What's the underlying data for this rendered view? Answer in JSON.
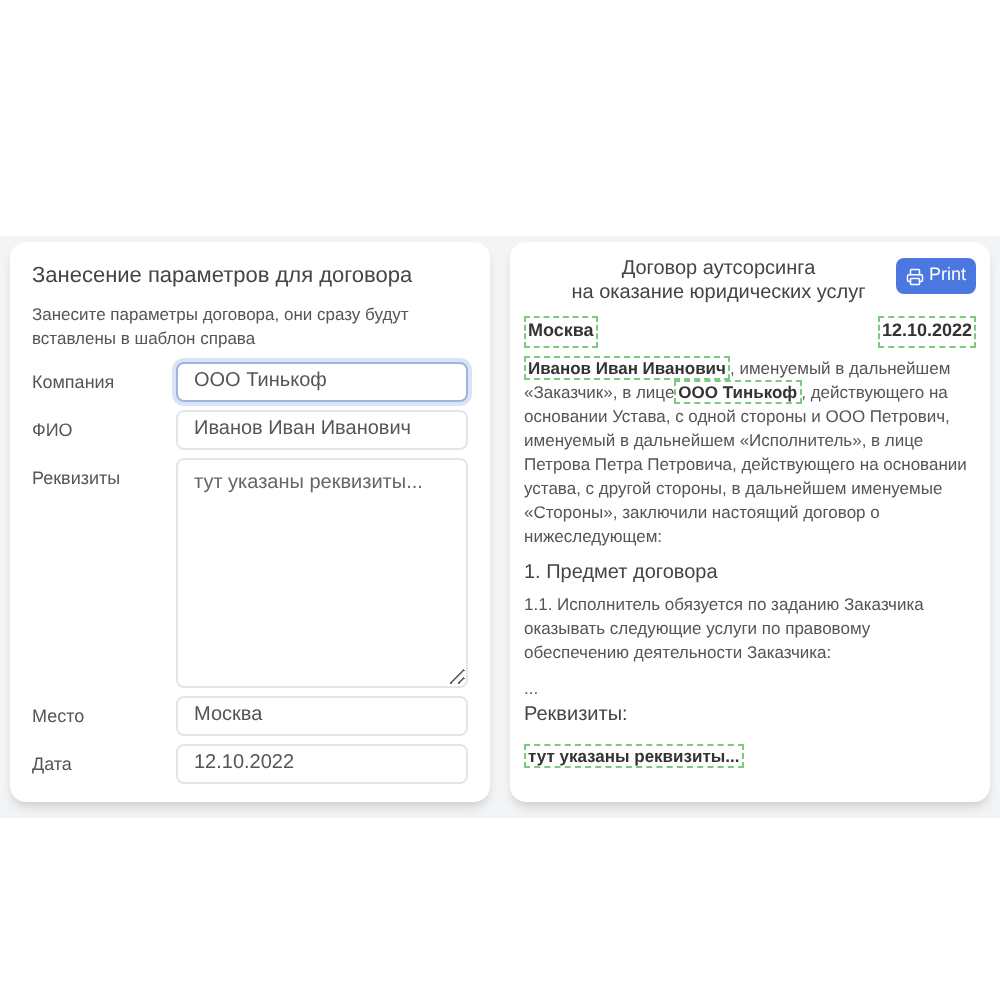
{
  "form": {
    "title": "Занесение параметров для договора",
    "hint": "Занесите параметры договора, они сразу будут вставлены в шаблон справа",
    "fields": [
      {
        "label": "Компания",
        "kind": "input",
        "value": "ООО Тинькоф",
        "focused": true
      },
      {
        "label": "ФИО",
        "kind": "input",
        "value": "Иванов Иван Иванович",
        "focused": false
      },
      {
        "label": "Реквизиты",
        "kind": "textarea",
        "placeholder": "тут указаны реквизиты...",
        "focused": false
      },
      {
        "label": "Место",
        "kind": "input",
        "value": "Москва",
        "focused": false
      },
      {
        "label": "Дата",
        "kind": "input",
        "value": "12.10.2022",
        "focused": false
      }
    ]
  },
  "document": {
    "title_lines": [
      "Договор аутсорсинга",
      "на оказание юридических услуг"
    ],
    "print_button": "Print",
    "place": "Москва",
    "date": "12.10.2022",
    "intro": [
      {
        "kind": "field",
        "text": "Иванов Иван Иванович"
      },
      {
        "kind": "text",
        "text": ", именуемый в дальнейшем «Заказчик», в лице"
      },
      {
        "kind": "field",
        "text": "ООО Тинькоф"
      },
      {
        "kind": "text",
        "text": ", действующего на основании Устава, с одной стороны и ООО Петрович, именуемый в дальнейшем «Исполнитель», в лице Петрова Петра Петровича, действующего на основании устава, с другой стороны, в дальнейшем именуемые «Стороны», заключили настоящий договор о нижеследующем:"
      }
    ],
    "section_heading": "1. Предмет договора",
    "section_text": "1.1. Исполнитель обязуется по заданию Заказчика оказывать следующие услуги по правовому обеспечению деятельности Заказчика:",
    "ellipsis": "...",
    "requisites_heading": "Реквизиты:",
    "requisites": "тут указаны реквизиты..."
  }
}
